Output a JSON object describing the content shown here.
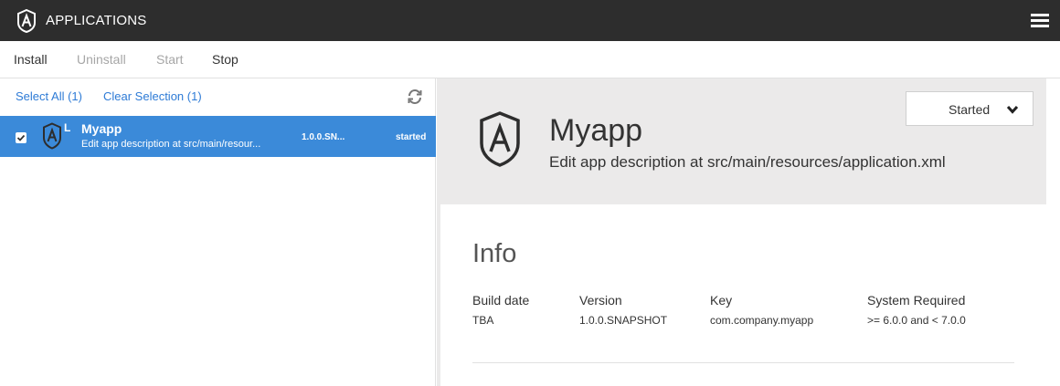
{
  "topbar": {
    "title": "APPLICATIONS",
    "logo_icon": "angular-a-logo",
    "menu_icon": "hamburger-icon"
  },
  "toolbar": {
    "install": "Install",
    "uninstall": "Uninstall",
    "start": "Start",
    "stop": "Stop"
  },
  "list": {
    "select_all": "Select All (1)",
    "clear_selection": "Clear Selection (1)",
    "refresh_icon": "refresh-icon",
    "rows": [
      {
        "letter": "L",
        "name": "Myapp",
        "description": "Edit app description at src/main/resour...",
        "version": "1.0.0.SN...",
        "status": "started",
        "checked": true
      }
    ]
  },
  "detail": {
    "name": "Myapp",
    "description": "Edit app description at src/main/resources/application.xml",
    "status_dropdown": "Started",
    "info": {
      "title": "Info",
      "columns": [
        {
          "header": "Build date",
          "value": "TBA"
        },
        {
          "header": "Version",
          "value": "1.0.0.SNAPSHOT"
        },
        {
          "header": "Key",
          "value": "com.company.myapp"
        },
        {
          "header": "System Required",
          "value": ">= 6.0.0 and < 7.0.0"
        }
      ]
    }
  },
  "colors": {
    "topbar": "#2d2d2d",
    "selection": "#3b8ad9",
    "link": "#2e7bd6",
    "header_bg": "#ebeaea"
  }
}
